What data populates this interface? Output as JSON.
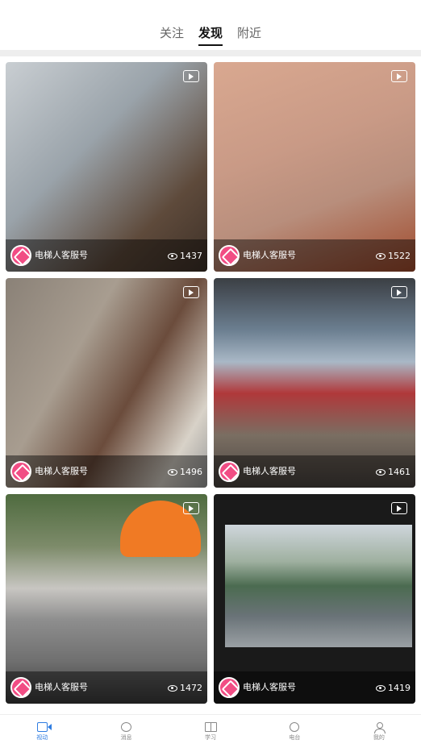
{
  "tabs": [
    {
      "label": "关注",
      "active": false
    },
    {
      "label": "发现",
      "active": true
    },
    {
      "label": "附近",
      "active": false
    }
  ],
  "feed": [
    {
      "author": "电梯人客服号",
      "views": "1437",
      "icon": "play-icon"
    },
    {
      "author": "电梯人客服号",
      "views": "1522",
      "icon": "play-icon"
    },
    {
      "author": "电梯人客服号",
      "views": "1496",
      "icon": "play-icon"
    },
    {
      "author": "电梯人客服号",
      "views": "1461",
      "icon": "play-icon"
    },
    {
      "author": "电梯人客服号",
      "views": "1472",
      "icon": "play-icon"
    },
    {
      "author": "电梯人客服号",
      "views": "1419",
      "icon": "play-icon"
    }
  ],
  "bottom_nav": [
    {
      "label": "视动",
      "icon": "video-icon",
      "active": true
    },
    {
      "label": "消息",
      "icon": "message-icon",
      "active": false
    },
    {
      "label": "学习",
      "icon": "book-icon",
      "active": false
    },
    {
      "label": "电台",
      "icon": "radio-icon",
      "active": false
    },
    {
      "label": "我的",
      "icon": "user-icon",
      "active": false
    }
  ],
  "colors": {
    "accent": "#2f7de1",
    "avatar": "#f14d84"
  }
}
